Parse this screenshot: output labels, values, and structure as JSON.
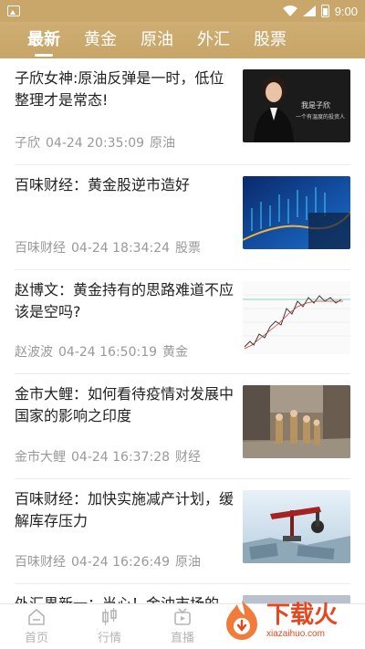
{
  "status": {
    "time": "9:00"
  },
  "tabs": [
    {
      "label": "最新",
      "active": true
    },
    {
      "label": "黄金",
      "active": false
    },
    {
      "label": "原油",
      "active": false
    },
    {
      "label": "外汇",
      "active": false
    },
    {
      "label": "股票",
      "active": false
    }
  ],
  "feed": [
    {
      "title": "子欣女神:原油反弹是一时，低位整理才是常态!",
      "author": "子欣",
      "time": "04-24 20:35:09",
      "category": "原油",
      "thumb": "portrait",
      "thumb_caption_1": "我是子欣",
      "thumb_caption_2": "一个有温度的投资人"
    },
    {
      "title": "百味财经：黄金股逆市造好",
      "author": "百味财经",
      "time": "04-24 18:34:24",
      "category": "股票",
      "thumb": "stock-screen"
    },
    {
      "title": "赵博文：黄金持有的思路难道不应该是空吗?",
      "author": "赵波波",
      "time": "04-24 16:50:19",
      "category": "黄金",
      "thumb": "candlestick"
    },
    {
      "title": "金市大鲤：如何看待疫情对发展中国家的影响之印度",
      "author": "金市大鲤",
      "time": "04-24 16:37:28",
      "category": "财经",
      "thumb": "street"
    },
    {
      "title": "百味财经：加快实施减产计划，缓解库存压力",
      "author": "百味财经",
      "time": "04-24 16:26:49",
      "category": "原油",
      "thumb": "oil-pump"
    },
    {
      "title": "外汇界新一：当心！金油市场的",
      "author": "",
      "time": "",
      "category": "",
      "thumb": "partial"
    }
  ],
  "bottom_nav": [
    {
      "label": "首页",
      "icon": "home-icon"
    },
    {
      "label": "行情",
      "icon": "quotes-icon"
    },
    {
      "label": "直播",
      "icon": "live-icon"
    }
  ],
  "watermark": {
    "main": "下载火",
    "sub": "xiazaihuo.com"
  },
  "colors": {
    "accent": "#c9a76a",
    "meta": "#999999"
  }
}
